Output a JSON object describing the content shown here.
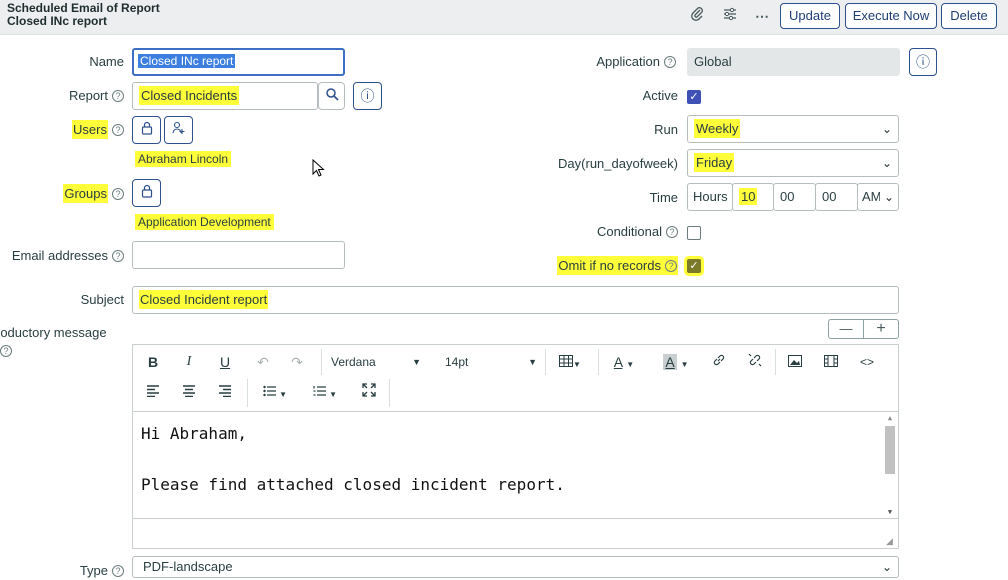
{
  "header": {
    "title_line1": "Scheduled Email of Report",
    "title_line2": "Closed INc report",
    "update_label": "Update",
    "execute_label": "Execute Now",
    "delete_label": "Delete",
    "icons": [
      "paperclip-icon",
      "settings-sliders-icon",
      "more-icon"
    ]
  },
  "form": {
    "name_label": "Name",
    "name_value": "Closed INc report",
    "report_label": "Report",
    "report_value": "Closed Incidents",
    "users_label": "Users",
    "users_value": "Abraham Lincoln",
    "groups_label": "Groups",
    "groups_value": "Application Development",
    "email_label": "Email addresses",
    "email_value": "",
    "subject_label": "Subject",
    "subject_value": "Closed Incident report",
    "intro_label": "roductory message",
    "application_label": "Application",
    "application_value": "Global",
    "active_label": "Active",
    "active_checked": true,
    "run_label": "Run",
    "run_value": "Weekly",
    "day_label": "Day(run_dayofweek)",
    "day_value": "Friday",
    "time_label": "Time",
    "time_hours_label": "Hours",
    "time_hour": "10",
    "time_min": "00",
    "time_sec": "00",
    "time_ampm": "AM",
    "conditional_label": "Conditional",
    "conditional_checked": false,
    "omit_label": "Omit if no records",
    "omit_checked": true,
    "type_label": "Type",
    "type_value": "PDF-landscape"
  },
  "editor": {
    "font_family": "Verdana",
    "font_size": "14pt",
    "line1": "Hi Abraham,",
    "line2": "Please find attached closed incident report.",
    "collapse_symbol": "—",
    "expand_symbol": "+"
  },
  "colors": {
    "highlight": "#ffff3a",
    "accent": "#2e4f8e",
    "checkbox": "#3f51b5",
    "checkbox_hl": "#7a7a28"
  }
}
